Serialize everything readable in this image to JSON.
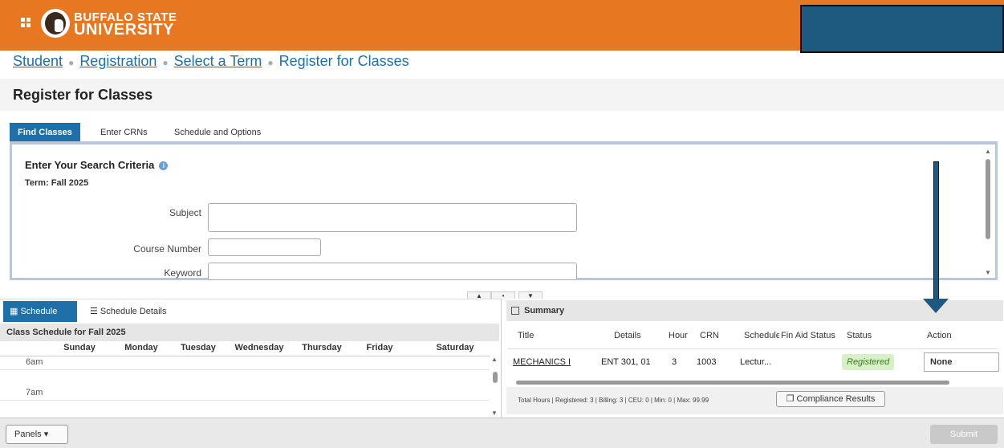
{
  "header": {
    "logo_line1": "BUFFALO STATE",
    "logo_line2": "UNIVERSITY",
    "grid_icon": "apps-grid-icon"
  },
  "breadcrumb": {
    "items": [
      "Student",
      "Registration",
      "Select a Term"
    ],
    "current": "Register for Classes"
  },
  "page": {
    "title": "Register for Classes"
  },
  "tabs": [
    {
      "label": "Find Classes"
    },
    {
      "label": "Enter CRNs"
    },
    {
      "label": "Schedule and Options"
    }
  ],
  "search": {
    "title": "Enter Your Search Criteria",
    "term": "Term: Fall 2025",
    "subject_label": "Subject",
    "course_label": "Course Number",
    "keyword_label": "Keyword"
  },
  "splitter": {
    "up": "▲",
    "mid": "•",
    "down": "▼"
  },
  "schedule": {
    "tab_active": "Schedule",
    "tab_details": "Schedule Details",
    "header": "Class Schedule for Fall 2025",
    "days": [
      "Sunday",
      "Monday",
      "Tuesday",
      "Wednesday",
      "Thursday",
      "Friday",
      "Saturday"
    ],
    "times": [
      "6am",
      "7am"
    ]
  },
  "summary": {
    "title": "Summary",
    "columns": [
      "Title",
      "Details",
      "Hours",
      "CRN",
      "Schedule",
      "Fin Aid Status",
      "Status",
      "Action"
    ],
    "rows": [
      {
        "title": "MECHANICS I",
        "details": "ENT 301, 01",
        "hours": "3",
        "crn": "1003",
        "schedule": "Lectur...",
        "fin_aid": "",
        "status": "Registered",
        "action": "None"
      }
    ],
    "totals": "Total Hours | Registered: 3 | Billing: 3 | CEU: 0 | Min: 0 | Max: 99.99",
    "compliance_button": "Compliance Results"
  },
  "footer": {
    "panels_button": "Panels",
    "submit_button": "Submit"
  },
  "colors": {
    "brand_orange": "#e87722",
    "accent_blue": "#1f6fa8",
    "annotation_blue": "#1e5a80",
    "registered_bg": "#d8f0c8"
  }
}
